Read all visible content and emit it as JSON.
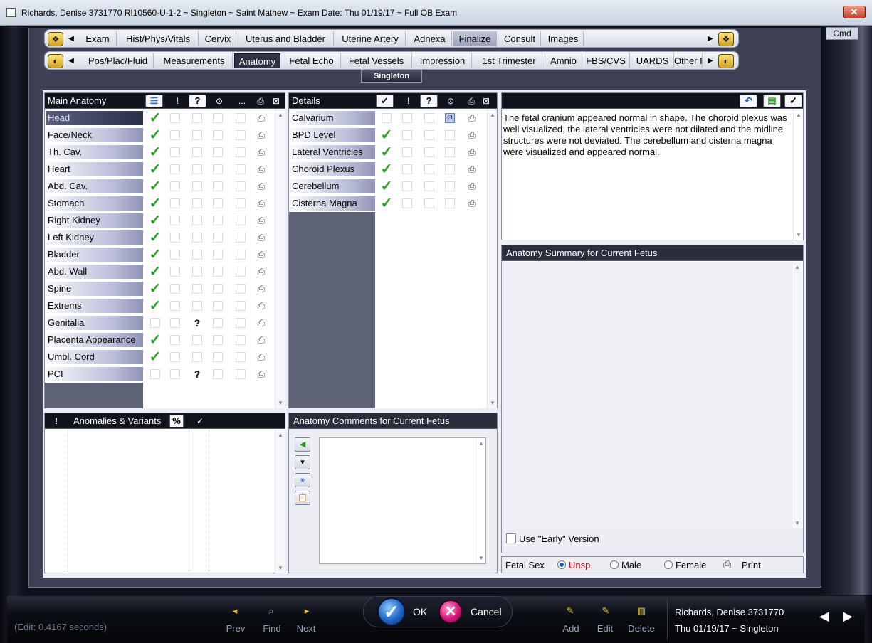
{
  "window": {
    "title": "Richards, Denise  3731770 RI10560-U-1-2 ~ Singleton ~ Saint Mathew ~ Exam Date: Thu 01/19/17 ~ Full OB Exam",
    "close_glyph": "✕",
    "cmd_label": "Cmd"
  },
  "tabs_row1": [
    "Exam",
    "Hist/Phys/Vitals",
    "Cervix",
    "Uterus and Bladder",
    "Uterine Artery",
    "Adnexa",
    "Finalize",
    "Consult",
    "Images"
  ],
  "tabs_row2": [
    "Pos/Plac/Fluid",
    "Measurements",
    "Anatomy",
    "Fetal Echo",
    "Fetal Vessels",
    "Impression",
    "1st Trimester",
    "Amnio",
    "FBS/CVS",
    "UARDS",
    "Other I"
  ],
  "active_tab_row1": "Finalize",
  "active_tab_row2": "Anatomy",
  "fetus_label": "Singleton",
  "main_anatomy": {
    "header": "Main Anatomy",
    "col_excl": "!",
    "col_q": "?",
    "col_eye": "⊙",
    "col_more": "...",
    "items": [
      {
        "label": "Head",
        "checked": true,
        "question": false,
        "selected": true
      },
      {
        "label": "Face/Neck",
        "checked": true,
        "question": false
      },
      {
        "label": "Th. Cav.",
        "checked": true,
        "question": false
      },
      {
        "label": "Heart",
        "checked": true,
        "question": false
      },
      {
        "label": "Abd. Cav.",
        "checked": true,
        "question": false
      },
      {
        "label": "Stomach",
        "checked": true,
        "question": false
      },
      {
        "label": "Right Kidney",
        "checked": true,
        "question": false
      },
      {
        "label": "Left Kidney",
        "checked": true,
        "question": false
      },
      {
        "label": "Bladder",
        "checked": true,
        "question": false
      },
      {
        "label": "Abd. Wall",
        "checked": true,
        "question": false
      },
      {
        "label": "Spine",
        "checked": true,
        "question": false
      },
      {
        "label": "Extrems",
        "checked": true,
        "question": false
      },
      {
        "label": "Genitalia",
        "checked": false,
        "question": true
      },
      {
        "label": "Placenta Appearance",
        "checked": true,
        "question": false
      },
      {
        "label": "Umbl. Cord",
        "checked": true,
        "question": false
      },
      {
        "label": "PCI",
        "checked": false,
        "question": true
      }
    ]
  },
  "details": {
    "header": "Details",
    "col_check": "✓",
    "col_excl": "!",
    "col_q": "?",
    "col_eye": "⊙",
    "items": [
      {
        "label": "Calvarium",
        "checked": false,
        "eye": true
      },
      {
        "label": "BPD Level",
        "checked": true
      },
      {
        "label": "Lateral Ventricles",
        "checked": true
      },
      {
        "label": "Choroid Plexus",
        "checked": true
      },
      {
        "label": "Cerebellum",
        "checked": true
      },
      {
        "label": "Cisterna Magna",
        "checked": true
      }
    ]
  },
  "narrative": {
    "text": "The fetal cranium appeared normal in shape. The choroid plexus was well visualized, the lateral ventricles were not dilated and the midline structures were not deviated. The cerebellum and cisterna magna were visualized and appeared normal.",
    "undo_glyph": "↶",
    "check_glyph": "✓"
  },
  "summary": {
    "header": "Anatomy Summary for Current Fetus",
    "early_version_label": "Use \"Early\" Version",
    "early_version_checked": false
  },
  "fetal_sex": {
    "label": "Fetal Sex",
    "options": [
      "Unsp.",
      "Male",
      "Female"
    ],
    "selected": "Unsp.",
    "print_label": "Print",
    "selected_color": "#c0101a"
  },
  "anomalies": {
    "excl": "!",
    "header": "Anomalies & Variants",
    "pct_glyph": "%",
    "check_glyph": "✓"
  },
  "comments": {
    "header": "Anatomy Comments for Current Fetus"
  },
  "bottom": {
    "edit_time": "(Edit: 0.4167 seconds)",
    "prev": "Prev",
    "find": "Find",
    "next": "Next",
    "ok": "OK",
    "cancel": "Cancel",
    "add": "Add",
    "edit": "Edit",
    "delete": "Delete",
    "patient": "Richards, Denise  3731770",
    "date": "Thu 01/19/17 ~ Singleton"
  },
  "colors": {
    "check_green": "#2c9a22",
    "header_dark": "#12141d",
    "accent_blue": "#1d64c8",
    "cancel_pink": "#d4177a"
  }
}
